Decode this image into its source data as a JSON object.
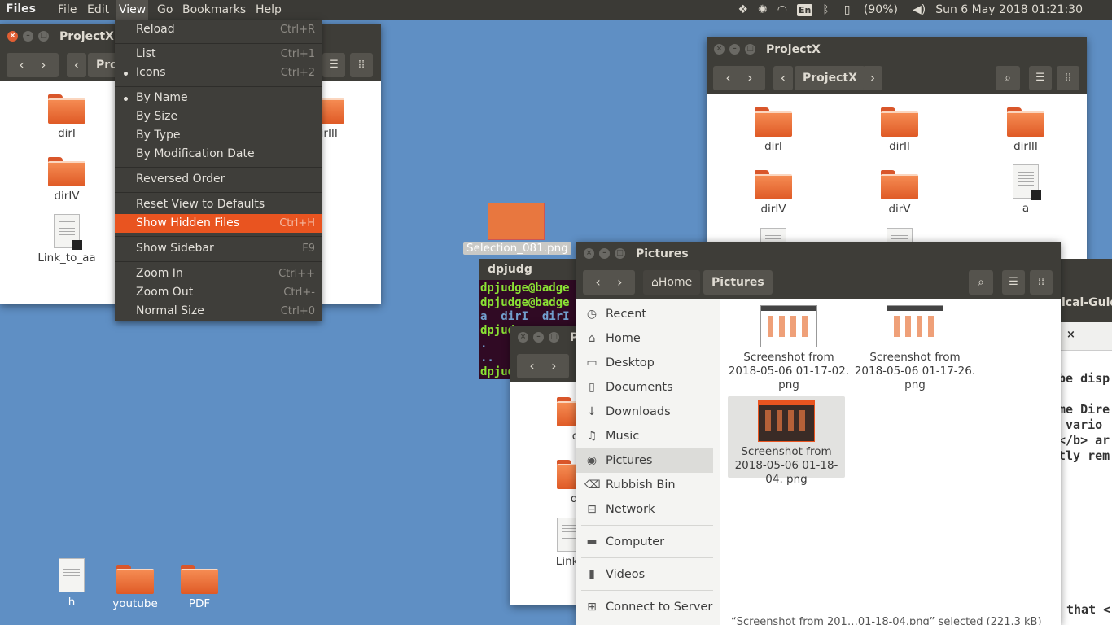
{
  "topbar": {
    "app": "Files",
    "menus": [
      "File",
      "Edit",
      "View",
      "Go",
      "Bookmarks",
      "Help"
    ],
    "keyboard": "En",
    "battery": "(90%)",
    "datetime": "Sun  6 May 2018 01:21:30"
  },
  "view_menu": {
    "items": [
      {
        "label": "Reload",
        "accel": "Ctrl+R"
      },
      {
        "label": "List",
        "accel": "Ctrl+1"
      },
      {
        "label": "Icons",
        "accel": "Ctrl+2"
      },
      {
        "label": "By Name",
        "accel": ""
      },
      {
        "label": "By Size",
        "accel": ""
      },
      {
        "label": "By Type",
        "accel": ""
      },
      {
        "label": "By Modification Date",
        "accel": ""
      },
      {
        "label": "Reversed Order",
        "accel": ""
      },
      {
        "label": "Reset View to Defaults",
        "accel": ""
      },
      {
        "label": "Show Hidden Files",
        "accel": "Ctrl+H"
      },
      {
        "label": "Show Sidebar",
        "accel": "F9"
      },
      {
        "label": "Zoom In",
        "accel": "Ctrl++"
      },
      {
        "label": "Zoom Out",
        "accel": "Ctrl+-"
      },
      {
        "label": "Normal Size",
        "accel": "Ctrl+0"
      }
    ]
  },
  "win_left": {
    "title": "ProjectX",
    "crumb": "Pro",
    "files": [
      "dirI",
      "dirIV",
      "Link_to_aa",
      "dirIII"
    ]
  },
  "win_right": {
    "title": "ProjectX",
    "crumb": "ProjectX",
    "files": [
      "dirI",
      "dirII",
      "dirIII",
      "dirIV",
      "dirV",
      "a"
    ]
  },
  "desktop": {
    "selection_file": "Selection_081.png",
    "icons": [
      "h",
      "youtube",
      "PDF"
    ]
  },
  "terminal": {
    "title": "dpjudg",
    "lines": [
      "dpjudge@badge",
      "dpjudge@badge",
      "a  dirI  dirI",
      "dpjud",
      ".",
      "..",
      "dpjud"
    ]
  },
  "win_middle": {
    "title": "P",
    "files": [
      "d",
      "di",
      "Link_"
    ]
  },
  "pictures": {
    "title": "Pictures",
    "crumb_home": "Home",
    "crumb_current": "Pictures",
    "sidebar": [
      "Recent",
      "Home",
      "Desktop",
      "Documents",
      "Downloads",
      "Music",
      "Pictures",
      "Rubbish Bin",
      "Network",
      "Computer",
      "Videos",
      "Connect to Server"
    ],
    "files": [
      "Screenshot from 2018-05-06 01-17-02. png",
      "Screenshot from 2018-05-06 01-17-26. png",
      "Screenshot from 2018-05-06 01-18-04. png"
    ],
    "status": "“Screenshot from 201…01-18-04.png” selected (221.3 kB)"
  },
  "editor": {
    "tab": "ical-Guid",
    "lines": [
      "be disp",
      "me Dire",
      " vario",
      "</b> ar",
      "tly rem",
      "that <"
    ]
  }
}
